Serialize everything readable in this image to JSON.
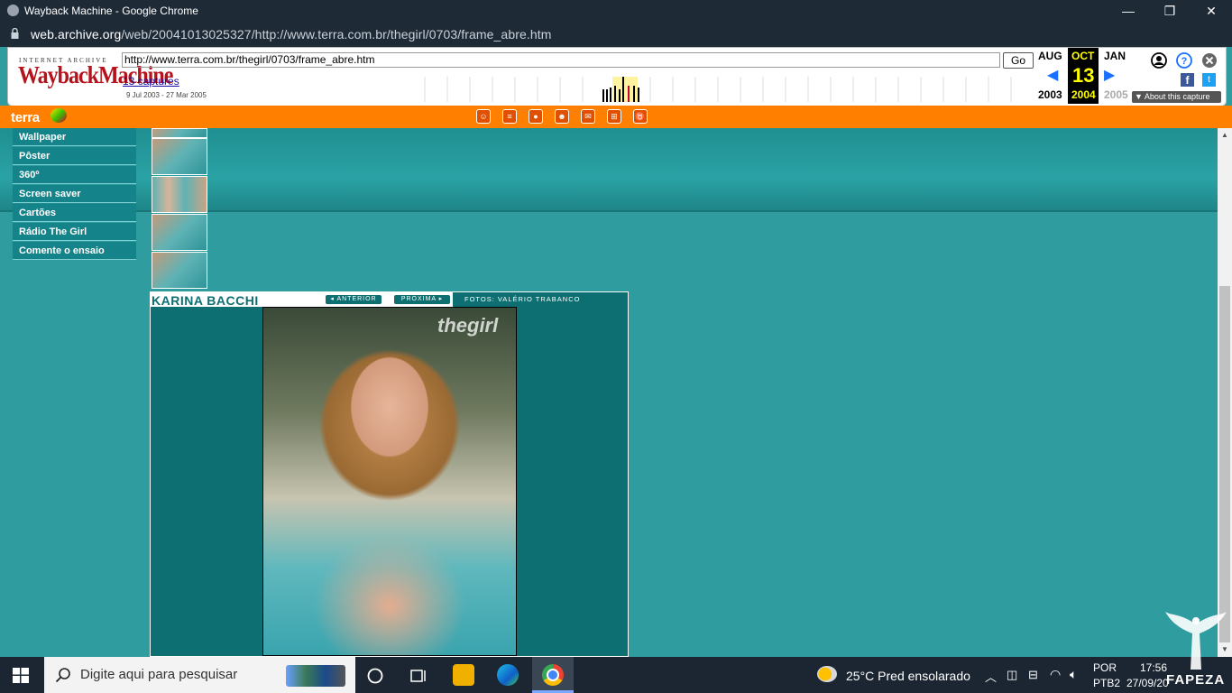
{
  "window": {
    "title": "Wayback Machine - Google Chrome",
    "min": "—",
    "max": "❐",
    "close": "✕"
  },
  "address": {
    "host": "web.archive.org",
    "path": "/web/20041013025327/http://www.terra.com.br/thegirl/0703/frame_abre.htm"
  },
  "wayback": {
    "logo_top": "INTERNET ARCHIVE",
    "logo": "WaybackMachine",
    "url_value": "http://www.terra.com.br/thegirl/0703/frame_abre.htm",
    "go_label": "Go",
    "captures_label": "13 captures",
    "date_range": "9 Jul 2003 - 27 Mar 2005",
    "prev_month": "AUG",
    "prev_year": "2003",
    "cur_month": "OCT",
    "cur_day": "13",
    "cur_year": "2004",
    "next_month": "JAN",
    "next_year": "2005",
    "about_label": "▼ About this capture"
  },
  "terra": {
    "logo": "terra"
  },
  "sidebar": {
    "items": [
      {
        "label": "Wallpaper"
      },
      {
        "label": "Pôster"
      },
      {
        "label": "360º"
      },
      {
        "label": "Screen saver"
      },
      {
        "label": "Cartões"
      },
      {
        "label": "Rádio The Girl"
      },
      {
        "label": "Comente o ensaio"
      }
    ]
  },
  "gallery": {
    "model_name": "KARINA BACCHI",
    "prev_label": "◂ ANTERIOR",
    "next_label": "PRÓXIMA ▸",
    "credit": "FOTOS: VALÉRIO TRABANCO",
    "watermark": "thegirl"
  },
  "taskbar": {
    "search_placeholder": "Digite aqui para pesquisar",
    "weather": "25°C  Pred ensolarado",
    "lang_top": "POR",
    "lang_bottom": "PTB2",
    "time": "17:56",
    "date": "27/09/20",
    "watermark": "FAPEZA"
  },
  "colors": {
    "accent_orange": "#ff8000",
    "teal": "#2f9da0",
    "dark_teal": "#0d6f71",
    "wayback_red": "#b5121b"
  }
}
